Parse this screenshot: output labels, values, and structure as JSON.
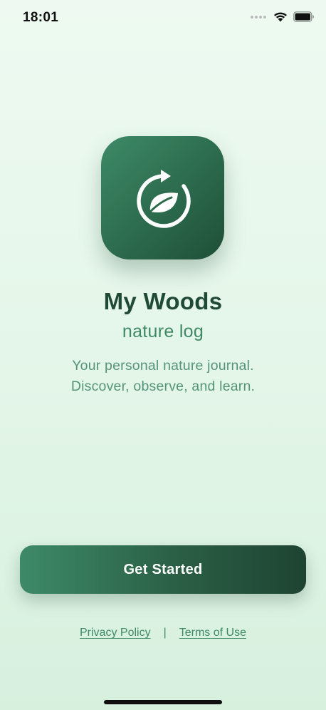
{
  "status_bar": {
    "time": "18:01"
  },
  "app": {
    "icon": "leaf-refresh-icon",
    "title": "My Woods",
    "subtitle": "nature log",
    "tagline_lines": [
      "Your personal nature journal.",
      "Discover, observe, and learn."
    ]
  },
  "actions": {
    "get_started_label": "Get Started"
  },
  "footer": {
    "privacy_label": "Privacy Policy",
    "separator": "|",
    "terms_label": "Terms of Use"
  },
  "colors": {
    "brand_green": "#2c6a4c",
    "accent_green": "#3e8a66",
    "title_green": "#1f4a36",
    "background": "#e4f6e9"
  }
}
